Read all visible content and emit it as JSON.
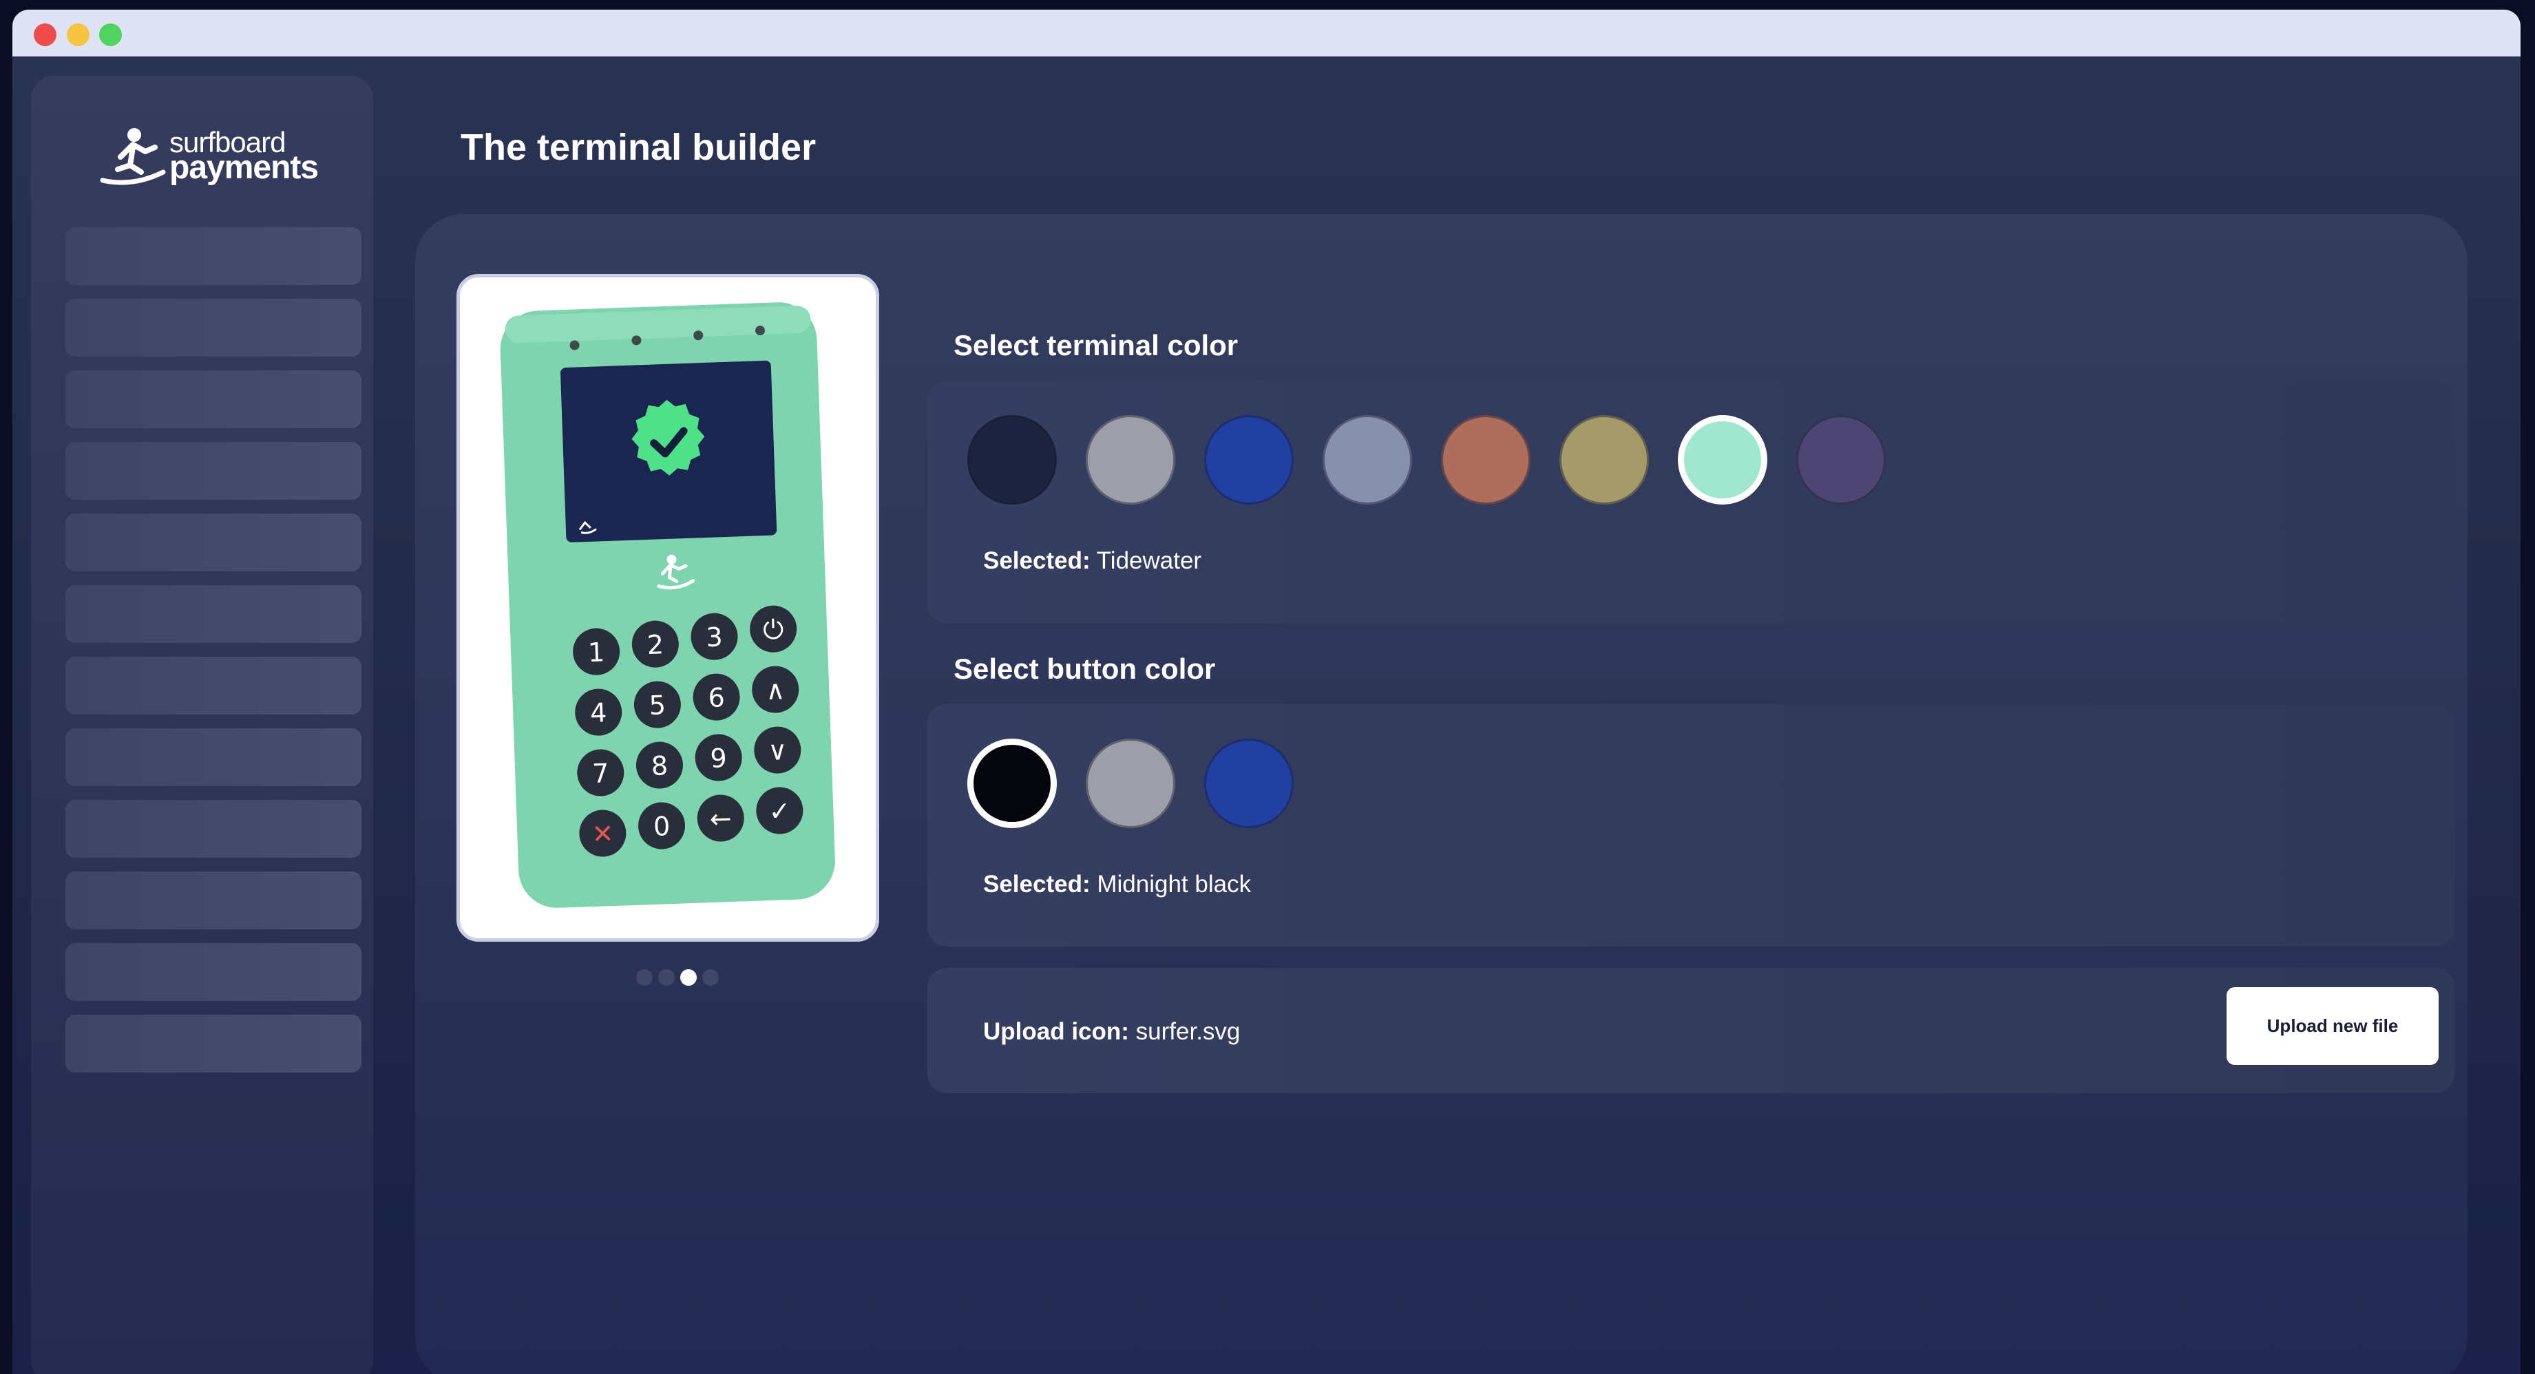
{
  "app": {
    "logo_line1": "surfboard",
    "logo_line2": "payments",
    "page_title": "The terminal builder"
  },
  "sidebar": {
    "item_count": 12
  },
  "terminal_color": {
    "title": "Select terminal color",
    "options": [
      {
        "name": "color-navy",
        "hex": "#1e2440"
      },
      {
        "name": "color-gray",
        "hex": "#9c9ea8"
      },
      {
        "name": "color-blue",
        "hex": "#2240a2"
      },
      {
        "name": "color-slate",
        "hex": "#8790ad"
      },
      {
        "name": "color-terracotta",
        "hex": "#ad6e5e"
      },
      {
        "name": "color-olive",
        "hex": "#a59a6a"
      },
      {
        "name": "color-tidewater",
        "hex": "#9fe8cf"
      },
      {
        "name": "color-purple",
        "hex": "#4d4672"
      }
    ],
    "selected_index": 6,
    "selected_label": "Selected:",
    "selected_value": "Tidewater"
  },
  "button_color": {
    "title": "Select button color",
    "options": [
      {
        "name": "color-midnight-black",
        "hex": "#04060c"
      },
      {
        "name": "color-gray",
        "hex": "#9c9ea8"
      },
      {
        "name": "color-blue",
        "hex": "#2240a2"
      }
    ],
    "selected_index": 0,
    "selected_label": "Selected:",
    "selected_value": "Midnight black"
  },
  "upload": {
    "label": "Upload icon:",
    "filename": "surfer.svg",
    "button_label": "Upload new file"
  },
  "carousel": {
    "count": 4,
    "active_index": 2
  },
  "terminal": {
    "body_color": "#7fd4b0",
    "key_color": "#2a2d3a",
    "keys": [
      "1",
      "2",
      "3",
      "⏻",
      "4",
      "5",
      "6",
      "∧",
      "7",
      "8",
      "9",
      "∨",
      "✕",
      "0",
      "←",
      "✓"
    ]
  }
}
